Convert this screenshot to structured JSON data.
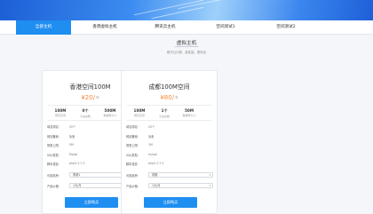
{
  "nav": {
    "tabs": [
      {
        "label": "全部主机",
        "active": true
      },
      {
        "label": "香港虚拟主机",
        "active": false
      },
      {
        "label": "腾讯云主机",
        "active": false
      },
      {
        "label": "空间测试1",
        "active": false
      },
      {
        "label": "空间测试2",
        "active": false
      }
    ]
  },
  "heading": {
    "title": "虚拟主机",
    "subtitle": "稳不云计算、高性能、更安全"
  },
  "cards": [
    {
      "title": "香港空间100M",
      "price": "¥20/",
      "price_unit": "年",
      "stats": [
        {
          "value": "100M",
          "label": "网页空间"
        },
        {
          "value": "0个",
          "label": "子站总数"
        },
        {
          "value": "500M",
          "label": "数据库大小"
        }
      ],
      "rows": [
        {
          "key": "域名绑定:",
          "value": "20个"
        },
        {
          "key": "网站备案:",
          "value": "免备"
        },
        {
          "key": "带宽上限:",
          "value": "5M"
        },
        {
          "key": "SQL类型:",
          "value": "Mysql"
        },
        {
          "key": "脚本语言:",
          "value": "php5.3-7.3"
        }
      ],
      "selects": [
        {
          "key": "可选机房:",
          "value": "香港1"
        },
        {
          "key": "产品价格:",
          "value": "1元/月"
        }
      ],
      "button": "立即购买"
    },
    {
      "title": "成都100M空间",
      "price": "¥80/",
      "price_unit": "年",
      "stats": [
        {
          "value": "100M",
          "label": "网页空间"
        },
        {
          "value": "1个",
          "label": "子站总数"
        },
        {
          "value": "50M",
          "label": "数据库大小"
        }
      ],
      "rows": [
        {
          "key": "域名绑定:",
          "value": "20个"
        },
        {
          "key": "网站备案:",
          "value": "免备"
        },
        {
          "key": "带宽上限:",
          "value": "1M"
        },
        {
          "key": "SQL类型:",
          "value": "mysql"
        },
        {
          "key": "脚本语言:",
          "value": "php5.3-7.3"
        }
      ],
      "selects": [
        {
          "key": "可选机房:",
          "value": "成都"
        },
        {
          "key": "产品价格:",
          "value": "1元/月"
        }
      ],
      "button": "立即购买"
    }
  ],
  "colors": {
    "accent": "#1f8ef1",
    "price": "#f7893b"
  }
}
